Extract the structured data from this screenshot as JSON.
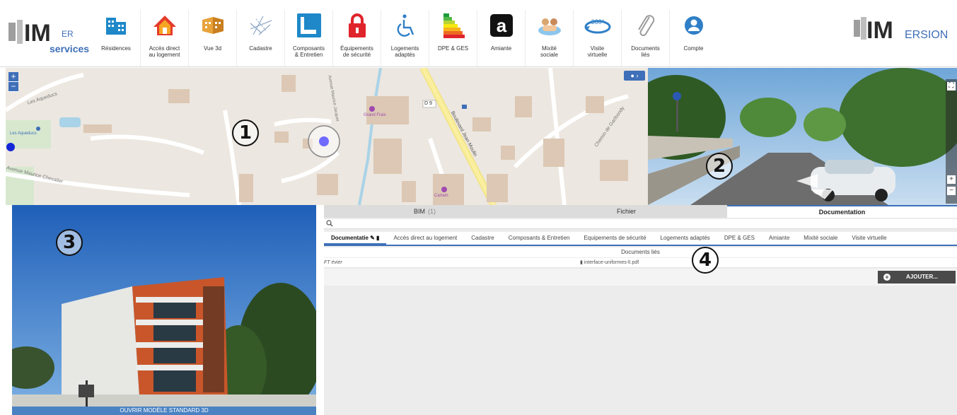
{
  "brand": {
    "left_logo_text": "BIM",
    "left_logo_sub": "services",
    "right_logo_text": "BIMERSION"
  },
  "toolbar": {
    "items": [
      {
        "label": "Résidences",
        "icon": "buildings-icon"
      },
      {
        "label": "Accès direct\nau logement",
        "icon": "house-icon"
      },
      {
        "label": "Vue 3d",
        "icon": "3d-view-icon"
      },
      {
        "label": "Cadastre",
        "icon": "cadastre-icon"
      },
      {
        "label": "Composants\n& Entretien",
        "icon": "components-icon"
      },
      {
        "label": "Équipements\nde sécurité",
        "icon": "lock-icon"
      },
      {
        "label": "Logements\nadaptés",
        "icon": "wheelchair-icon"
      },
      {
        "label": "DPE & GES",
        "icon": "energy-label-icon"
      },
      {
        "label": "Amiante",
        "icon": "asbestos-icon"
      },
      {
        "label": "Mixité\nsociale",
        "icon": "people-icon"
      },
      {
        "label": "Visite\nvirtuelle",
        "icon": "360-icon"
      },
      {
        "label": "Documents\nliés",
        "icon": "paperclip-icon"
      },
      {
        "label": "Compte",
        "icon": "user-icon"
      }
    ]
  },
  "map": {
    "zoom_in": "+",
    "zoom_out": "−",
    "street_labels": [
      "Les Aqueducs",
      "Avenue Maurice Chevalier",
      "Avenue Maurice Jacquet",
      "Boulevard Jean Moulin",
      "Chemin de Garibondy",
      "D 9"
    ],
    "poi_labels": [
      "Les Aqueducs",
      "Grand Frais",
      "Cartam"
    ]
  },
  "callouts": [
    "1",
    "2",
    "3",
    "4"
  ],
  "photo": {
    "open_3d_label": "OUVRIR MODÈLE STANDARD 3D"
  },
  "panel": {
    "tabs": [
      {
        "label": "BIM",
        "count": "(1)"
      },
      {
        "label": "Fichier",
        "count": ""
      },
      {
        "label": "Documentation",
        "count": ""
      }
    ],
    "subtabs": [
      "Documentatie ✎ ▮",
      "Accès direct au logement",
      "Cadastre",
      "Composants & Entretien",
      "Equipements de sécurité",
      "Logements adaptés",
      "DPE & GES",
      "Amiante",
      "Mixité sociale",
      "Visite virtuelle"
    ],
    "docs_header": "Documents liés",
    "doc": {
      "name": "FT évier",
      "file": "interface-uniformes-lI.pdf"
    },
    "add_button": "AJOUTER..."
  },
  "colors": {
    "accent": "#3e6fb8",
    "panel_bg": "#ececec",
    "map_bg": "#ece7e0"
  }
}
